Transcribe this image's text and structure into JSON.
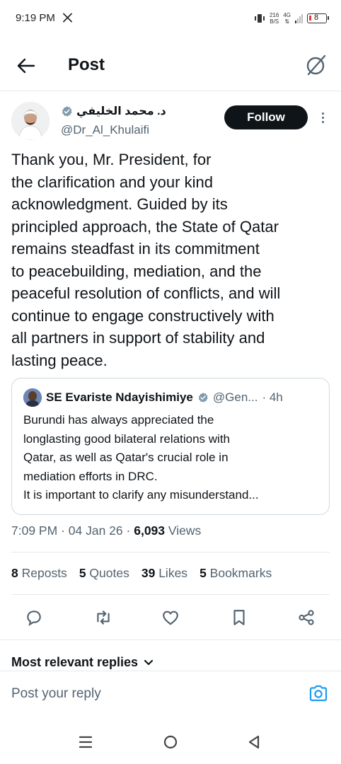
{
  "status_bar": {
    "time": "9:19 PM",
    "net_speed_value": "216",
    "net_speed_unit": "B/S",
    "net_type": "4G",
    "battery_level": "8",
    "battery_color": "#e53935"
  },
  "header": {
    "title": "Post",
    "back_icon": "arrow-left-icon",
    "grok_icon": "grok-icon"
  },
  "post": {
    "author_name": "د. محمد الخليفي",
    "author_handle": "@Dr_Al_Khulaifi",
    "follow_label": "Follow",
    "text": "Thank you, Mr. President, for\nthe clarification and your kind\nacknowledgment. Guided by its\nprincipled approach, the State of Qatar\nremains steadfast in its commitment\nto peacebuilding, mediation, and the\npeaceful resolution of conflicts, and will\ncontinue to engage constructively with\nall partners in support of stability and\nlasting peace.",
    "time": "7:09 PM",
    "date": "04 Jan 26",
    "views_count": "6,093",
    "views_label": "Views"
  },
  "quote": {
    "name": "SE Evariste Ndayishimiye",
    "handle": "@Gen...",
    "age": "· 4h",
    "text": "Burundi has always appreciated the\nlonglasting good bilateral relations with\nQatar, as well as Qatar's crucial role in\nmediation efforts in DRC.\nIt is important to clarify any misunderstand..."
  },
  "stats": [
    {
      "count": "8",
      "label": "Reposts"
    },
    {
      "count": "5",
      "label": "Quotes"
    },
    {
      "count": "39",
      "label": "Likes"
    },
    {
      "count": "5",
      "label": "Bookmarks"
    }
  ],
  "actions": [
    "reply-icon",
    "repost-icon",
    "like-icon",
    "bookmark-icon",
    "share-icon"
  ],
  "replies": {
    "sort_label": "Most relevant replies",
    "placeholder": "Post your reply"
  },
  "colors": {
    "accent": "#1d9bf0",
    "text_primary": "#0f1419",
    "text_secondary": "#536471",
    "follow_bg": "#0f1419"
  }
}
